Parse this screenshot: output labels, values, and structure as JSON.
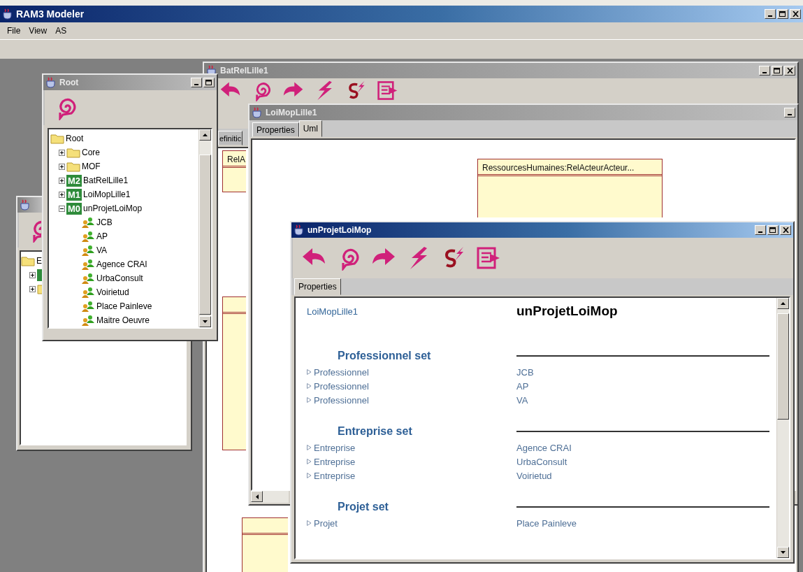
{
  "app": {
    "title": "RAM3 Modeler",
    "active": true,
    "controls": {
      "minimize": true,
      "maximize": true,
      "close": true
    }
  },
  "menu": [
    {
      "label": "File"
    },
    {
      "label": "View"
    },
    {
      "label": "AS"
    }
  ],
  "windows": [
    {
      "kind": "explorer",
      "active": false,
      "toolbar": [
        {
          "kind": "spiral"
        }
      ],
      "tree": [
        {
          "label": "E",
          "kind": "folder",
          "children": [
            {
              "kind": "model",
              "expanded": false
            },
            {
              "kind": "folder",
              "expanded": false
            }
          ]
        }
      ]
    },
    {
      "kind": "editor",
      "title": "BatRelLille1",
      "active": false,
      "controls": {
        "minimize": true,
        "maximize": true,
        "close": true
      },
      "toolbar": [
        {
          "kind": "back"
        },
        {
          "kind": "spiral"
        },
        {
          "kind": "forward"
        },
        {
          "kind": "bolt"
        },
        {
          "kind": "sbolt"
        },
        {
          "kind": "export"
        }
      ],
      "tabs": [
        {
          "label": "efinitic",
          "selected": false
        }
      ],
      "classes": [
        {
          "kind": "class",
          "name": "RelA"
        },
        {
          "kind": "class"
        },
        {
          "kind": "class"
        }
      ]
    },
    {
      "kind": "editor",
      "title": "LoiMopLille1",
      "active": false,
      "controls": {
        "minimize": true
      },
      "tabs": [
        {
          "label": "Properties",
          "selected": false
        },
        {
          "label": "Uml",
          "selected": true
        }
      ],
      "classes": [
        {
          "kind": "class",
          "name": "RessourcesHumaines:RelActeurActeur..."
        }
      ],
      "hscroll": true
    },
    {
      "kind": "explorer",
      "title": "Root",
      "active": false,
      "controls": {
        "minimize": true,
        "maximize": true
      },
      "toolbar": [
        {
          "kind": "spiral"
        }
      ],
      "tree": [
        {
          "label": "Root",
          "kind": "folder",
          "children": [
            {
              "label": "Core",
              "kind": "folder",
              "expanded": false
            },
            {
              "label": "MOF",
              "kind": "folder",
              "expanded": false
            },
            {
              "label": "BatRelLille1",
              "kind": "model",
              "badge": "M2",
              "expanded": false
            },
            {
              "label": "LoiMopLille1",
              "kind": "model",
              "badge": "M1",
              "expanded": false
            },
            {
              "label": "unProjetLoiMop",
              "kind": "model",
              "badge": "M0",
              "expanded": true,
              "children": [
                {
                  "label": "JCB",
                  "kind": "element"
                },
                {
                  "label": "AP",
                  "kind": "element"
                },
                {
                  "label": "VA",
                  "kind": "element"
                },
                {
                  "label": "Agence CRAI",
                  "kind": "element"
                },
                {
                  "label": "UrbaConsult",
                  "kind": "element"
                },
                {
                  "label": "Voirietud",
                  "kind": "element"
                },
                {
                  "label": "Place Painleve",
                  "kind": "element"
                },
                {
                  "label": "Maitre Oeuvre",
                  "kind": "element"
                }
              ]
            }
          ]
        }
      ]
    },
    {
      "kind": "properties",
      "title": "unProjetLoiMop",
      "active": true,
      "controls": {
        "minimize": true,
        "maximize": true,
        "close": true
      },
      "toolbar": [
        {
          "kind": "back"
        },
        {
          "kind": "spiral"
        },
        {
          "kind": "forward"
        },
        {
          "kind": "bolt"
        },
        {
          "kind": "sbolt"
        },
        {
          "kind": "export"
        }
      ],
      "tabs": [
        {
          "label": "Properties",
          "selected": true
        }
      ],
      "header": {
        "link": "LoiMopLille1",
        "title": "unProjetLoiMop"
      },
      "sets": [
        {
          "title": "Professionnel set",
          "rows": [
            {
              "label": "Professionnel",
              "value": "JCB"
            },
            {
              "label": "Professionnel",
              "value": "AP"
            },
            {
              "label": "Professionnel",
              "value": "VA"
            }
          ]
        },
        {
          "title": "Entreprise set",
          "rows": [
            {
              "label": "Entreprise",
              "value": "Agence CRAI"
            },
            {
              "label": "Entreprise",
              "value": "UrbaConsult"
            },
            {
              "label": "Entreprise",
              "value": "Voirietud"
            }
          ]
        },
        {
          "title": "Projet set",
          "rows": [
            {
              "label": "Projet",
              "value": "Place Painleve"
            }
          ]
        }
      ]
    }
  ]
}
